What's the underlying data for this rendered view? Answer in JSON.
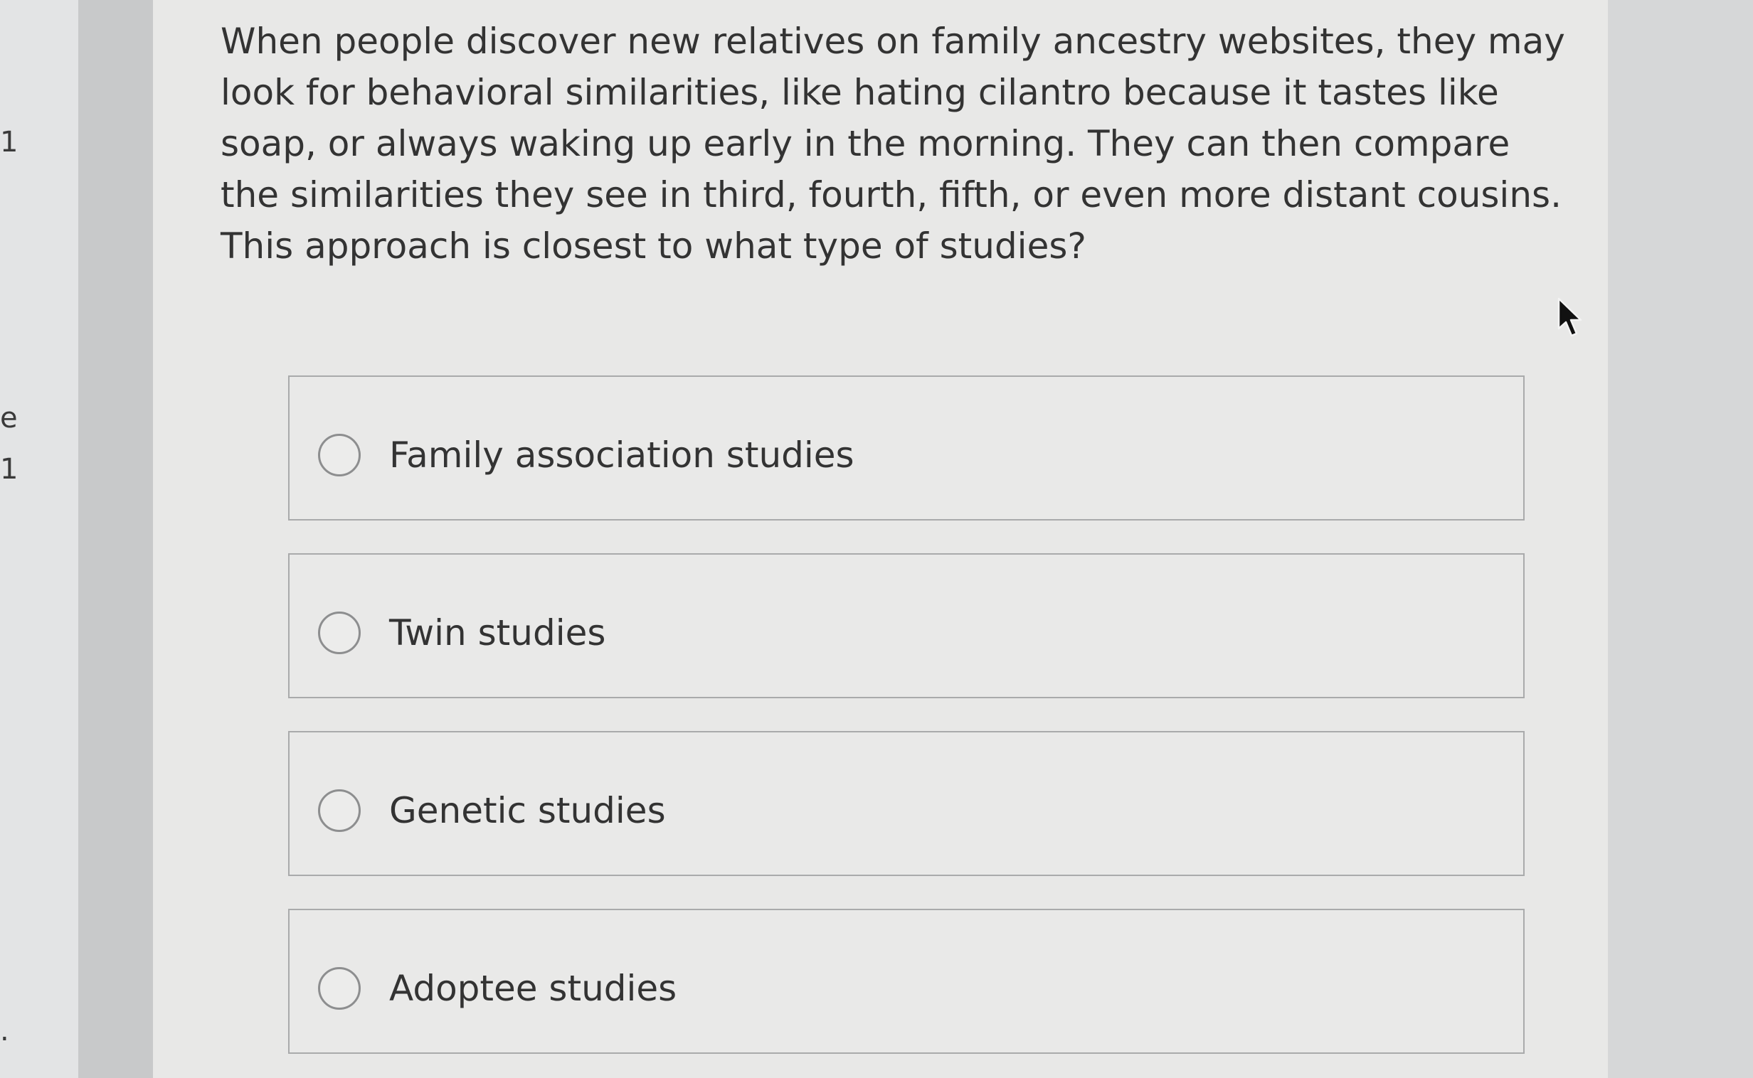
{
  "question": {
    "text": "When people discover new relatives on family ancestry websites, they may look for behavioral similarities, like hating cilantro because it tastes like soap, or always waking up early in the morning. They can then compare the similarities they see in third, fourth, fifth, or even more distant cousins. This approach is closest to what type of studies?"
  },
  "options": [
    {
      "label": "Family association studies",
      "selected": false
    },
    {
      "label": "Twin studies",
      "selected": false
    },
    {
      "label": "Genetic studies",
      "selected": false
    },
    {
      "label": "Adoptee studies",
      "selected": false
    }
  ],
  "left_marks": [
    "1",
    "e",
    "1",
    "."
  ],
  "icons": {
    "radio": "radio-button-icon",
    "cursor": "mouse-pointer-icon"
  }
}
